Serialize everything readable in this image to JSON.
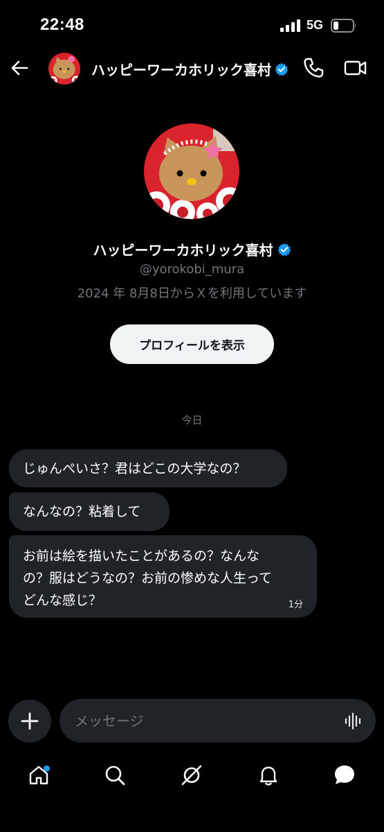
{
  "status_bar": {
    "time": "22:48",
    "network": "5G"
  },
  "header": {
    "name": "ハッピーワーカホリック喜村",
    "verified": true
  },
  "profile": {
    "name": "ハッピーワーカホリック喜村",
    "handle": "@yorokobi_mura",
    "joined": "2024 年 8月8日からＸを利用しています",
    "view_profile_label": "プロフィールを表示"
  },
  "conversation": {
    "date_separator": "今日",
    "messages": [
      {
        "lines": [
          "じゅんぺいさ？君はどこの大学なの？"
        ]
      },
      {
        "lines": [
          "なんなの？粘着して"
        ]
      },
      {
        "lines": [
          "お前は絵を描いたことがあるの？なんな",
          "の？服はどうなの？お前の惨めな人生って",
          "どんな感じ？"
        ],
        "time": "1分"
      }
    ]
  },
  "composer": {
    "placeholder": "メッセージ"
  },
  "colors": {
    "background": "#000000",
    "bubble": "#202327",
    "accent": "#1d9bf0",
    "muted_text": "#71767b"
  },
  "icons": {
    "back": "arrow-left-icon",
    "call": "phone-icon",
    "video": "video-camera-icon",
    "add": "plus-icon",
    "voice": "waveform-icon",
    "nav": [
      "home-icon",
      "search-icon",
      "grok-icon",
      "bell-icon",
      "messages-icon"
    ]
  }
}
